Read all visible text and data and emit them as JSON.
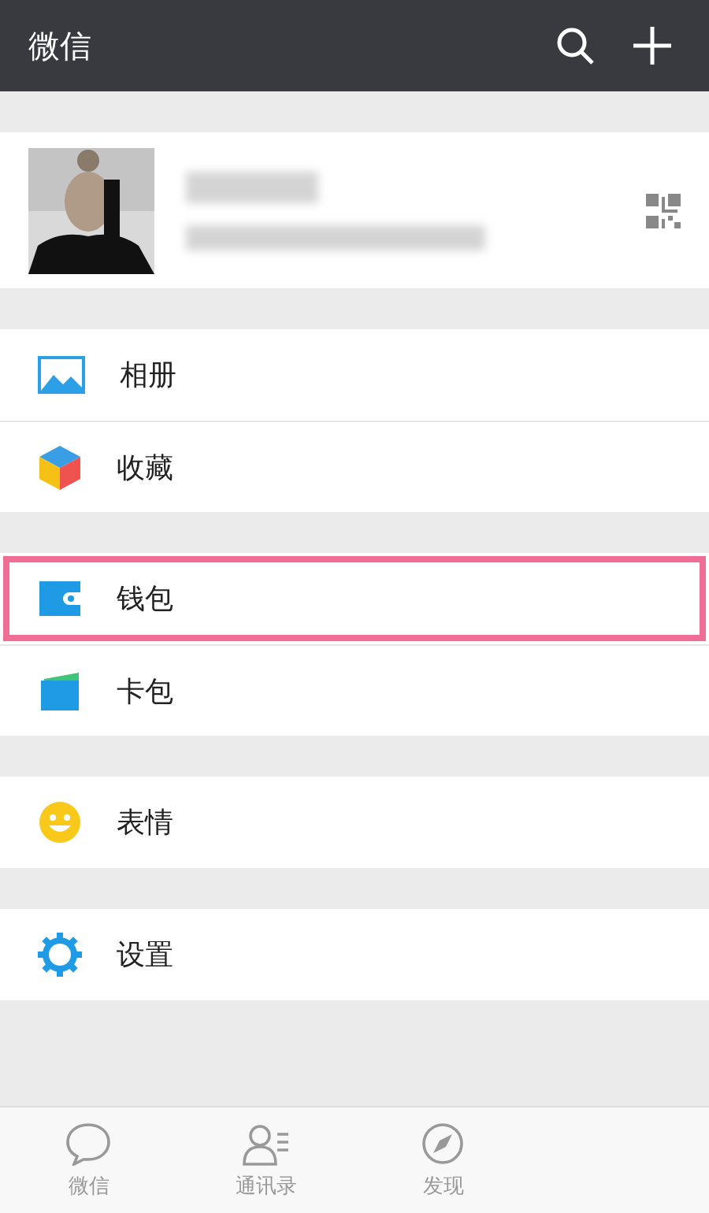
{
  "header": {
    "title": "微信"
  },
  "groups": [
    {
      "items": [
        {
          "kind": "album",
          "label": "相册",
          "highlighted": false
        },
        {
          "kind": "favorites",
          "label": "收藏",
          "highlighted": false
        }
      ]
    },
    {
      "items": [
        {
          "kind": "wallet",
          "label": "钱包",
          "highlighted": true
        },
        {
          "kind": "cards",
          "label": "卡包",
          "highlighted": false
        }
      ]
    },
    {
      "items": [
        {
          "kind": "stickers",
          "label": "表情",
          "highlighted": false
        }
      ]
    },
    {
      "items": [
        {
          "kind": "settings",
          "label": "设置",
          "highlighted": false
        }
      ]
    }
  ],
  "tabs": [
    {
      "kind": "chats",
      "label": "微信",
      "selected": false
    },
    {
      "kind": "contacts",
      "label": "通讯录",
      "selected": false
    },
    {
      "kind": "discover",
      "label": "发现",
      "selected": false
    }
  ]
}
